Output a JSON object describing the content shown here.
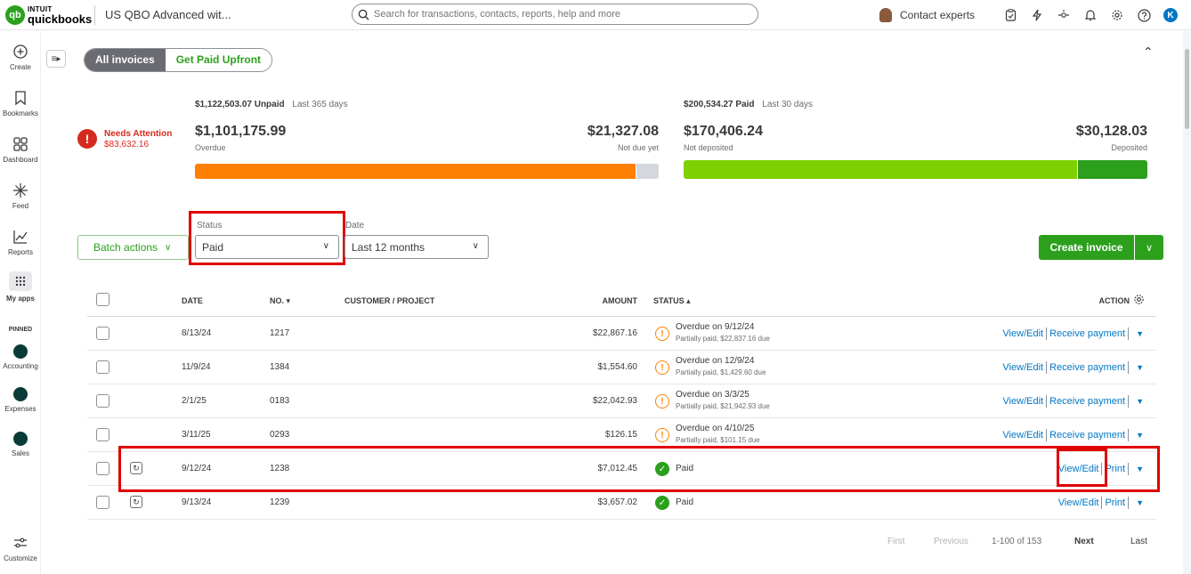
{
  "top": {
    "logo_mark": "qb",
    "logo_brand": "INTUIT",
    "logo_name": "quickbooks",
    "company": "US QBO Advanced wit...",
    "search_placeholder": "Search for transactions, contacts, reports, help and more",
    "contact_experts": "Contact experts",
    "avatar_initial": "K"
  },
  "nav": {
    "create": "Create",
    "bookmarks": "Bookmarks",
    "dashboard": "Dashboard",
    "feed": "Feed",
    "reports": "Reports",
    "my_apps": "My apps",
    "pinned": "PINNED",
    "accounting": "Accounting",
    "expenses": "Expenses",
    "sales": "Sales",
    "customize": "Customize"
  },
  "tabs": {
    "all": "All invoices",
    "upfront": "Get Paid Upfront"
  },
  "summary": {
    "unpaid_amount": "$1,122,503.07 Unpaid",
    "unpaid_period": "Last 365 days",
    "needs_title": "Needs Attention",
    "needs_amount": "$83,632.16",
    "overdue_amount": "$1,101,175.99",
    "overdue_label": "Overdue",
    "notdue_amount": "$21,327.08",
    "notdue_label": "Not due yet",
    "paid_amount": "$200,534.27 Paid",
    "paid_period": "Last 30 days",
    "notdeposited_amount": "$170,406.24",
    "notdeposited_label": "Not deposited",
    "deposited_amount": "$30,128.03",
    "deposited_label": "Deposited",
    "colors": {
      "overdue": "#ff8000",
      "notdue": "#d4d7dc",
      "notdeposited": "#7fd000",
      "deposited": "#2ca01c"
    }
  },
  "filters": {
    "status_label": "Status",
    "status_value": "Paid",
    "date_label": "Date",
    "date_value": "Last 12 months",
    "batch": "Batch actions",
    "create_invoice": "Create invoice"
  },
  "table": {
    "headers": {
      "date": "DATE",
      "no": "NO. ▾",
      "customer": "CUSTOMER / PROJECT",
      "amount": "AMOUNT",
      "status": "STATUS ▴",
      "action": "ACTION"
    },
    "rows": [
      {
        "date": "8/13/24",
        "no": "1217",
        "amount": "$22,867.16",
        "status": "Overdue on 9/12/24",
        "sub": "Partially paid, $22,837.16 due",
        "a1": "View/Edit",
        "a2": "Receive payment"
      },
      {
        "date": "11/9/24",
        "no": "1384",
        "amount": "$1,554.60",
        "status": "Overdue on 12/9/24",
        "sub": "Partially paid, $1,429.60 due",
        "a1": "View/Edit",
        "a2": "Receive payment"
      },
      {
        "date": "2/1/25",
        "no": "0183",
        "amount": "$22,042.93",
        "status": "Overdue on 3/3/25",
        "sub": "Partially paid, $21,942.93 due",
        "a1": "View/Edit",
        "a2": "Receive payment"
      },
      {
        "date": "3/11/25",
        "no": "0293",
        "amount": "$126.15",
        "status": "Overdue on 4/10/25",
        "sub": "Partially paid, $101.15 due",
        "a1": "View/Edit",
        "a2": "Receive payment"
      },
      {
        "date": "9/12/24",
        "no": "1238",
        "amount": "$7,012.45",
        "status": "Paid",
        "sub": "",
        "a1": "View/Edit",
        "a2": "Print"
      },
      {
        "date": "9/13/24",
        "no": "1239",
        "amount": "$3,657.02",
        "status": "Paid",
        "sub": "",
        "a1": "View/Edit",
        "a2": "Print"
      }
    ]
  },
  "pager": {
    "first": "First",
    "previous": "Previous",
    "range": "1-100 of 153",
    "next": "Next",
    "last": "Last"
  }
}
